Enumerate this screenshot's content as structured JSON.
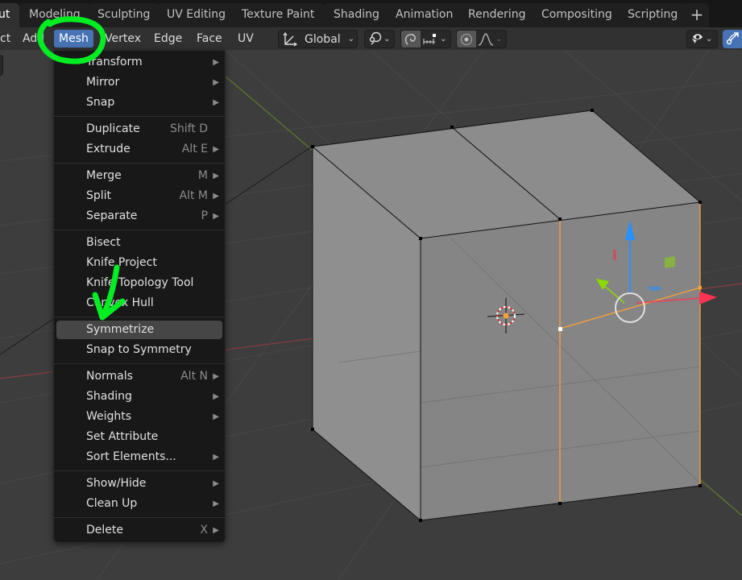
{
  "workspace_tabs": [
    {
      "label": "ut",
      "active": true
    },
    {
      "label": "Modeling",
      "active": false
    },
    {
      "label": "Sculpting",
      "active": false
    },
    {
      "label": "UV Editing",
      "active": false
    },
    {
      "label": "Texture Paint",
      "active": false
    },
    {
      "label": "Shading",
      "active": false
    },
    {
      "label": "Animation",
      "active": false
    },
    {
      "label": "Rendering",
      "active": false
    },
    {
      "label": "Compositing",
      "active": false
    },
    {
      "label": "Scripting",
      "active": false
    }
  ],
  "add_workspace_label": "+",
  "header_menus": [
    {
      "label": "ct"
    },
    {
      "label": "Add"
    },
    {
      "label": "Mesh",
      "open": true
    },
    {
      "label": "Vertex"
    },
    {
      "label": "Edge"
    },
    {
      "label": "Face"
    },
    {
      "label": "UV"
    }
  ],
  "toolbar": {
    "transform_orientation": {
      "icon": "transform-orientation-icon",
      "value": "Global"
    },
    "pivot_icon": "pivot-point-icon",
    "snap_icon": "magnet-snap-icon",
    "snap_target_icon": "snap-increment-icon",
    "proportional_icon": "proportional-edit-icon",
    "falloff_icon": "falloff-curve-icon",
    "visibility_icon": "selectability-eye-icon",
    "gizmo_icon": "gizmo-toggle-icon",
    "chevron": "⌄"
  },
  "mesh_menu": {
    "groups": [
      [
        {
          "label": "Transform",
          "submenu": true
        },
        {
          "label": "Mirror",
          "submenu": true
        },
        {
          "label": "Snap",
          "submenu": true
        }
      ],
      [
        {
          "label": "Duplicate",
          "shortcut": "Shift D"
        },
        {
          "label": "Extrude",
          "shortcut": "Alt E",
          "submenu": true
        }
      ],
      [
        {
          "label": "Merge",
          "shortcut": "M",
          "submenu": true
        },
        {
          "label": "Split",
          "shortcut": "Alt M",
          "submenu": true
        },
        {
          "label": "Separate",
          "shortcut": "P",
          "submenu": true
        }
      ],
      [
        {
          "label": "Bisect"
        },
        {
          "label": "Knife Project"
        },
        {
          "label": "Knife Topology Tool"
        },
        {
          "label": "Convex Hull"
        }
      ],
      [
        {
          "label": "Symmetrize",
          "highlighted": true
        },
        {
          "label": "Snap to Symmetry"
        }
      ],
      [
        {
          "label": "Normals",
          "shortcut": "Alt N",
          "submenu": true
        },
        {
          "label": "Shading",
          "submenu": true
        },
        {
          "label": "Weights",
          "submenu": true
        },
        {
          "label": "Set Attribute"
        },
        {
          "label": "Sort Elements...",
          "submenu": true
        }
      ],
      [
        {
          "label": "Show/Hide",
          "submenu": true
        },
        {
          "label": "Clean Up",
          "submenu": true
        }
      ],
      [
        {
          "label": "Delete",
          "shortcut": "X",
          "submenu": true
        }
      ]
    ],
    "submenu_glyph": "▶"
  },
  "colors": {
    "accent": "#4772b3",
    "annotation": "#00ee22",
    "axis_x": "#ff3352",
    "axis_y": "#8bdc00",
    "axis_z": "#2890ff",
    "selection": "#ffa033",
    "cube_face": "#8a8a8a"
  }
}
